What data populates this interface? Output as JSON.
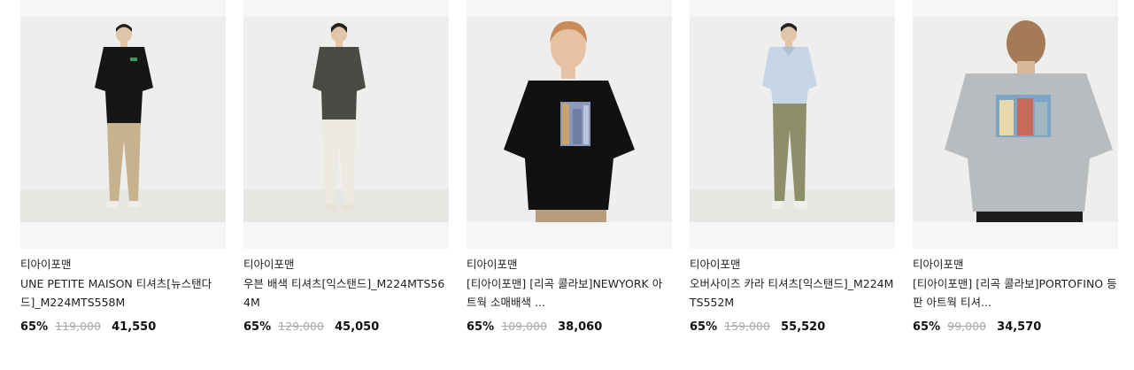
{
  "products": [
    {
      "brand": "티아이포맨",
      "title": "UNE PETITE MAISON 티셔츠[뉴스탠다드]_M224MTS558M",
      "discount": "65%",
      "original_price": "119,000",
      "price": "41,550",
      "image": "man-black-tshirt-beige-pants"
    },
    {
      "brand": "티아이포맨",
      "title": "우븐 배색 티셔츠[익스탠드]_M224MTS564M",
      "discount": "65%",
      "original_price": "129,000",
      "price": "45,050",
      "image": "man-charcoal-tshirt-white-pants"
    },
    {
      "brand": "티아이포맨",
      "title": "[티아이포맨] [리곡 콜라보]NEWYORK 아트웍 소매배색 ...",
      "discount": "65%",
      "original_price": "109,000",
      "price": "38,060",
      "image": "man-black-art-print-tshirt"
    },
    {
      "brand": "티아이포맨",
      "title": "오버사이즈 카라 티셔츠[익스탠드]_M224MTS552M",
      "discount": "65%",
      "original_price": "159,000",
      "price": "55,520",
      "image": "man-lightblue-collar-shirt-khaki-pants"
    },
    {
      "brand": "티아이포맨",
      "title": "[티아이포맨] [리곡 콜라보]PORTOFINO 등판 아트웍 티셔...",
      "discount": "65%",
      "original_price": "99,000",
      "price": "34,570",
      "image": "man-grey-tshirt-back-print"
    }
  ]
}
